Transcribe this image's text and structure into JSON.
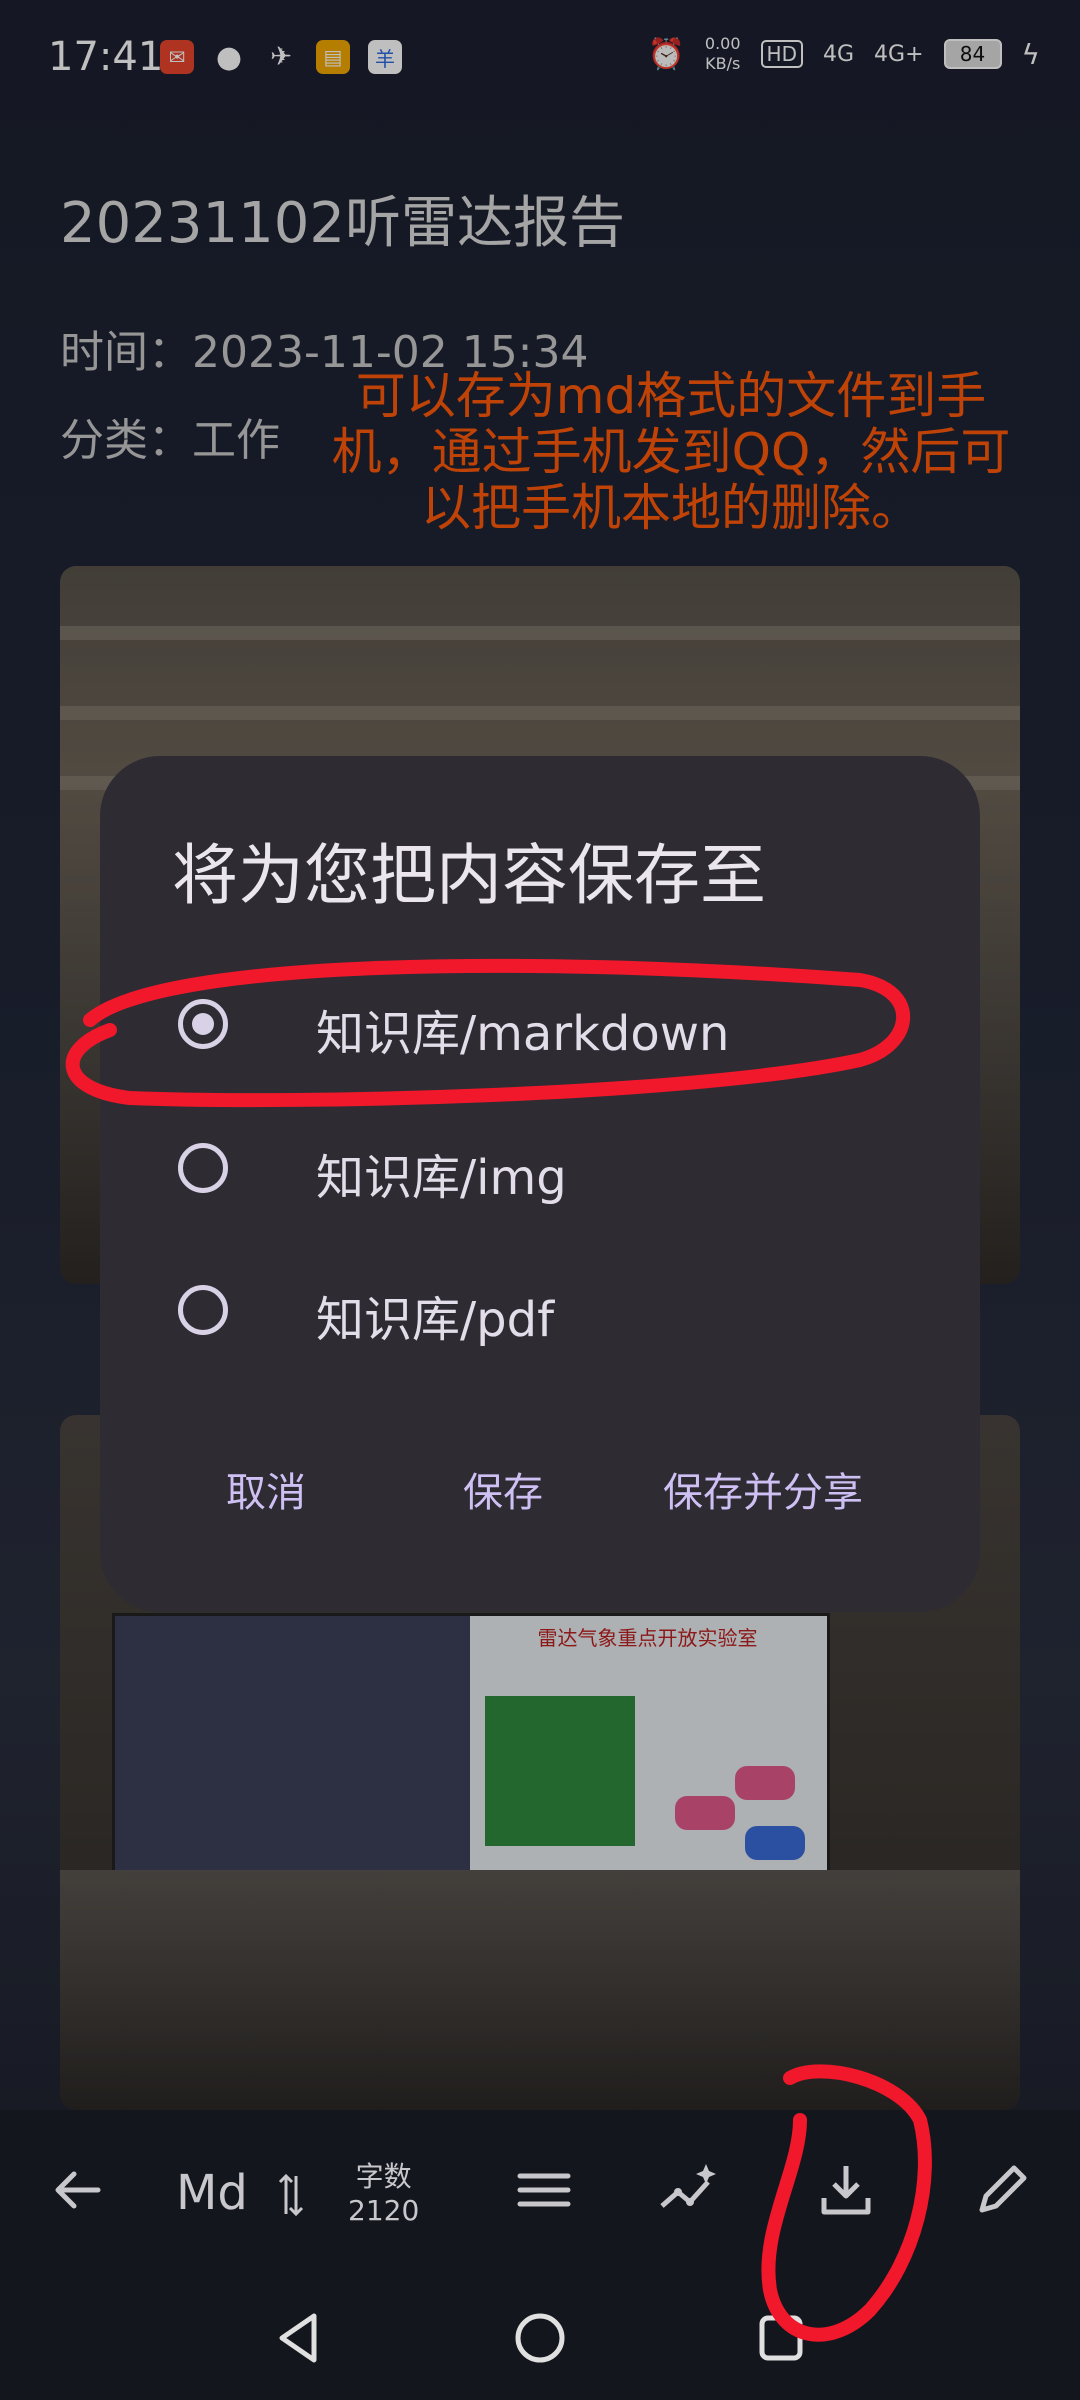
{
  "status_bar": {
    "time": "17:41",
    "net_speed": "0.00",
    "net_unit": "KB/s",
    "hd": "HD",
    "signal1": "4G",
    "signal2": "4G+",
    "battery": "84",
    "notification_icons": [
      "mail-app-icon",
      "chat-bubble-icon",
      "bird-app-icon",
      "folder-app-icon",
      "blue-app-icon"
    ]
  },
  "note": {
    "title": "20231102听雷达报告",
    "time_label": "时间：",
    "time_value": "2023-11-02 15:34",
    "category_label": "分类：",
    "category_value": "工作"
  },
  "annotation_text": "可以存为md格式的文件到手机，通过手机发到QQ，然后可以把手机本地的删除。",
  "photo_slide": {
    "title": "雷达气象重点开放实验室"
  },
  "dialog": {
    "title": "将为您把内容保存至",
    "options": [
      {
        "label": "知识库/markdown",
        "selected": true
      },
      {
        "label": "知识库/img",
        "selected": false
      },
      {
        "label": "知识库/pdf",
        "selected": false
      }
    ],
    "buttons": {
      "cancel": "取消",
      "save": "保存",
      "save_share": "保存并分享"
    }
  },
  "toolbar": {
    "md_label": "Md",
    "word_count_label": "字数",
    "word_count_value": "2120"
  },
  "colors": {
    "annotation": "#ff5a0a",
    "dialog_bg": "#2e2b33",
    "dialog_button": "#cfc0f4",
    "red_marker": "#f0182a"
  }
}
